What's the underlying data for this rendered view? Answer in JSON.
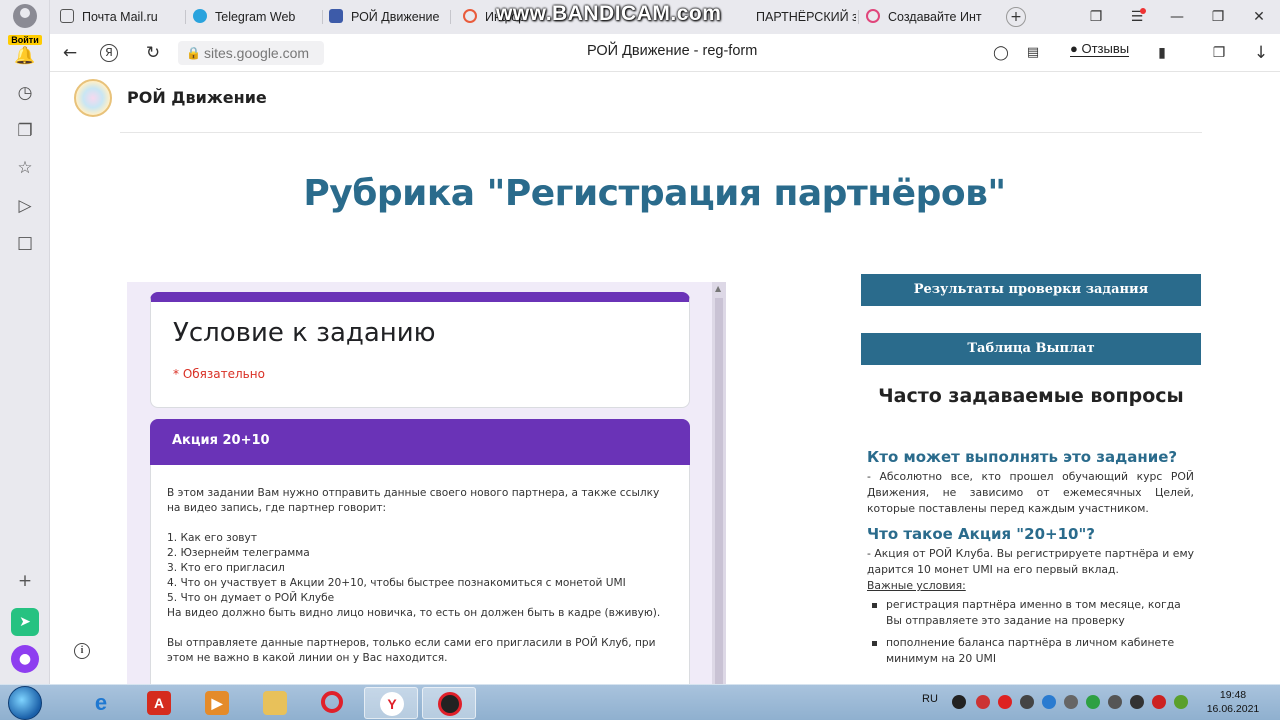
{
  "browser": {
    "login_label": "Войти",
    "tabs": [
      {
        "label": "Почта Mail.ru",
        "color": "#555555"
      },
      {
        "label": "Telegram Web",
        "color": "#2aa3dd"
      },
      {
        "label": "РОЙ Движение",
        "color": "#3d5ba9"
      },
      {
        "label": "Инфор",
        "color": "#e95b3b"
      },
      {
        "label": "ПАРТНЁРСКИЙ з",
        "color": "#888888"
      },
      {
        "label": "Создавайте Инт",
        "color": "#e0457b"
      }
    ],
    "url": "sites.google.com",
    "page_title": "РОЙ Движение - reg-form",
    "reviews_label": "Отзывы",
    "watermark": "www.BANDICAM.com"
  },
  "site": {
    "name": "РОЙ Движение",
    "headline": "Рубрика \"Регистрация партнёров\""
  },
  "form": {
    "title": "Условие к заданию",
    "required": "* Обязательно",
    "section_title": "Акция 20+10",
    "intro": "В этом задании Вам нужно отправить данные своего нового партнера, а также ссылку на видео запись, где партнер говорит:",
    "list": [
      "1. Как его зовут",
      "2. Юзернейм телеграмма",
      "3. Кто его пригласил",
      "4. Что он участвует в Акции 20+10, чтобы быстрее познакомиться с монетой UMI",
      "5. Что он думает о РОЙ Клубе"
    ],
    "video_note": "На видео должно быть видно лицо новичка, то есть он должен быть в кадре (вживую).",
    "footer_note": "Вы отправляете данные партнеров, только если сами его пригласили в РОЙ Клуб, при этом не важно в какой линии он у Вас находится."
  },
  "buttons": {
    "results": "Результаты проверки задания",
    "payouts": "Таблица Выплат"
  },
  "faq": {
    "title": "Часто задаваемые вопросы",
    "q1": "Кто может выполнять это задание?",
    "a1": "- Абсолютно все, кто прошел обучающий курс РОЙ Движения, не зависимо от ежемесячных Целей, которые поставлены перед каждым участником.",
    "q2": "Что такое Акция \"20+10\"?",
    "a2": "- Акция от РОЙ Клуба. Вы регистрируете партнёра и ему дарится 10 монет UMI на его первый вклад.",
    "conditions_label": "Важные условия:",
    "conditions": [
      "регистрация партнёра именно в том месяце, когда Вы отправляете это задание на проверку",
      "пополнение баланса партнёра в личном кабинете минимум на 20 UMI"
    ]
  },
  "taskbar": {
    "lang": "RU",
    "time": "19:48",
    "date": "16.06.2021"
  }
}
